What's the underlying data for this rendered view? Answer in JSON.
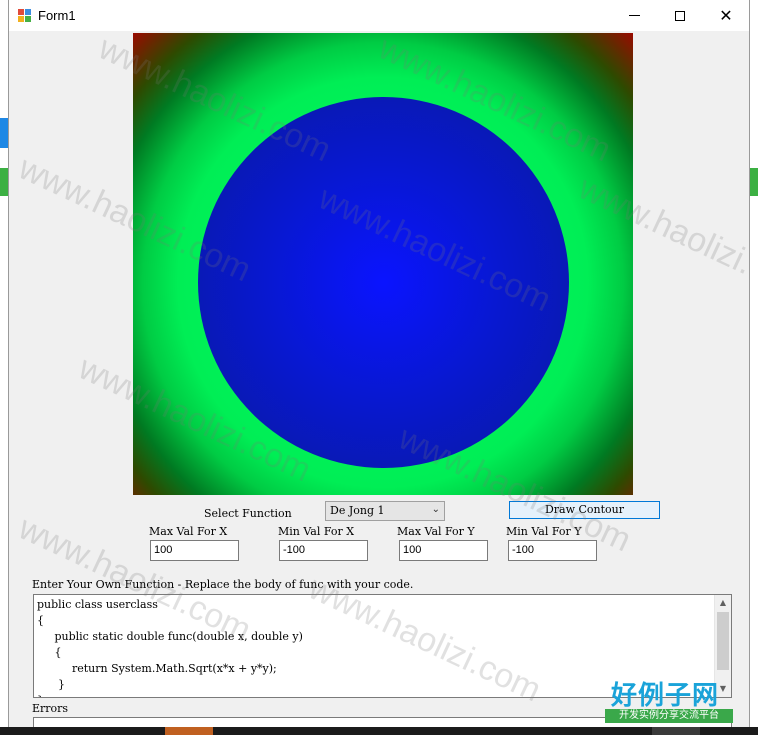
{
  "window": {
    "title": "Form1"
  },
  "controls": {
    "select_function_label": "Select Function",
    "function_select_value": "De Jong 1",
    "draw_button_label": "Draw Contour",
    "max_x_label": "Max Val For X",
    "min_x_label": "Min Val For X",
    "max_y_label": "Max Val For Y",
    "min_y_label": "Min Val For Y",
    "max_x_value": "100",
    "min_x_value": "-100",
    "max_y_value": "100",
    "min_y_value": "-100"
  },
  "code_section": {
    "label": "Enter Your Own Function - Replace the body of func with your code.",
    "lines": [
      "public class userclass",
      "{",
      "     public static double func(double x, double y)",
      "     {",
      "          return System.Math.Sqrt(x*x + y*y);",
      "      }",
      "}"
    ]
  },
  "errors_section": {
    "label": "Errors"
  },
  "watermarks": {
    "text": "www.haolizi.com",
    "logo_text": "好例子网",
    "logo_subtext": "开发实例分享交流平台"
  },
  "colors": {
    "contour_center": "#0a14ff",
    "contour_ring": "#00ff66",
    "contour_corner": "#e00000",
    "button_accent": "#0078d7"
  }
}
